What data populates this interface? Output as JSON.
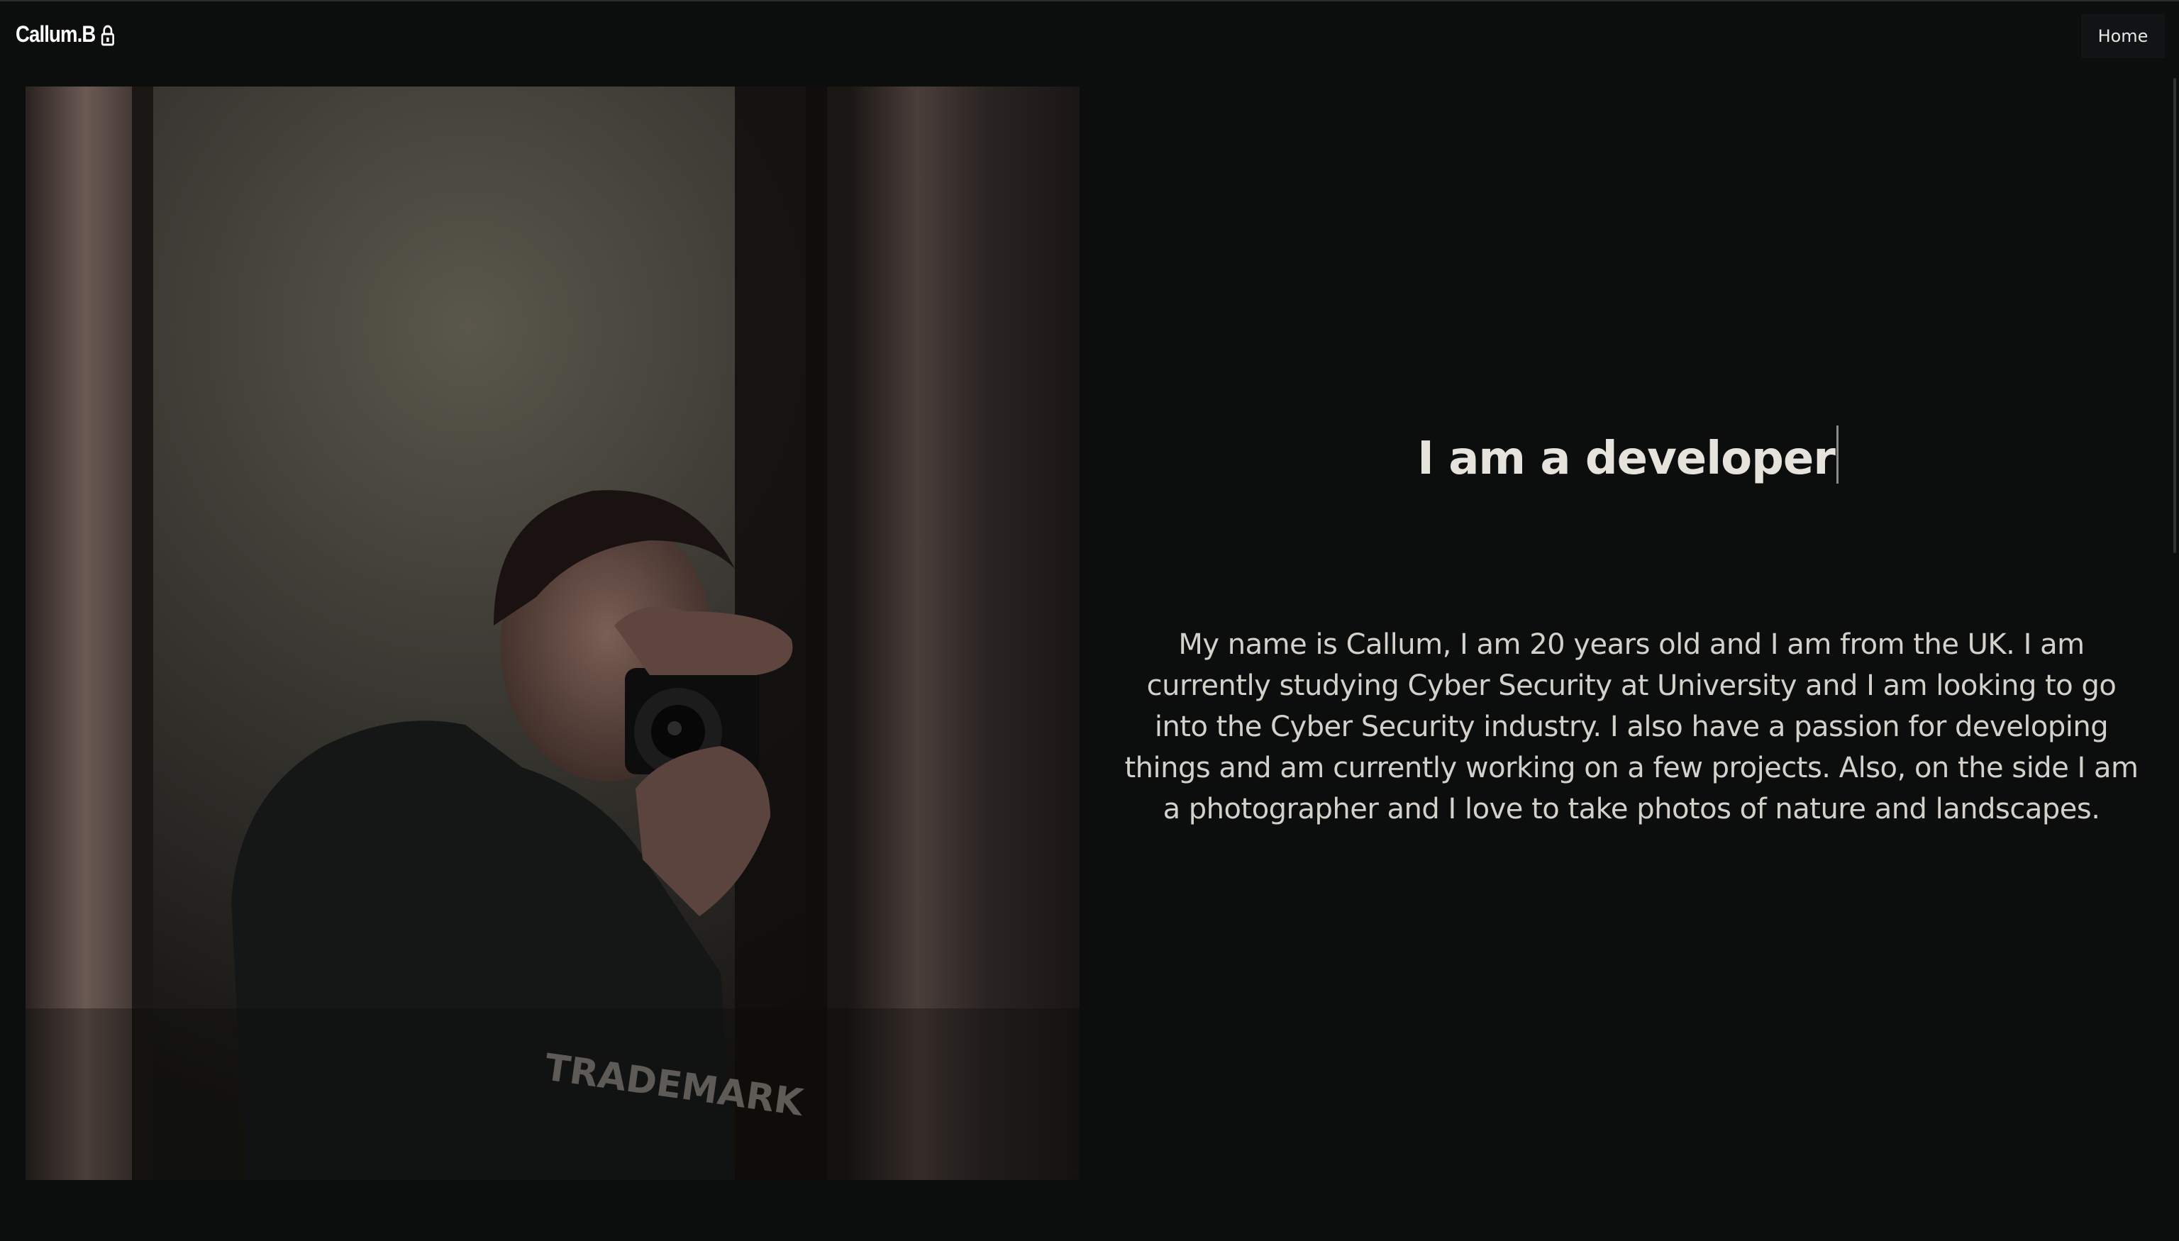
{
  "nav": {
    "brand": "Callum.B",
    "brand_icon": "lock-icon",
    "home_label": "Home"
  },
  "hero": {
    "title": "I am a developer",
    "bio": "My name is Callum, I am 20 years old and I am from the UK. I am currently studying Cyber Security at University and I am looking to go into the Cyber Security industry. I also have a passion for developing things and am currently working on a few projects. Also, on the side I am a photographer and I love to take photos of nature and landscapes."
  },
  "photo": {
    "shirt_text": "TRADEMARK"
  },
  "colors": {
    "background": "#0c0e0e",
    "text": "#d4d1cb",
    "title": "#e6e3dc"
  }
}
